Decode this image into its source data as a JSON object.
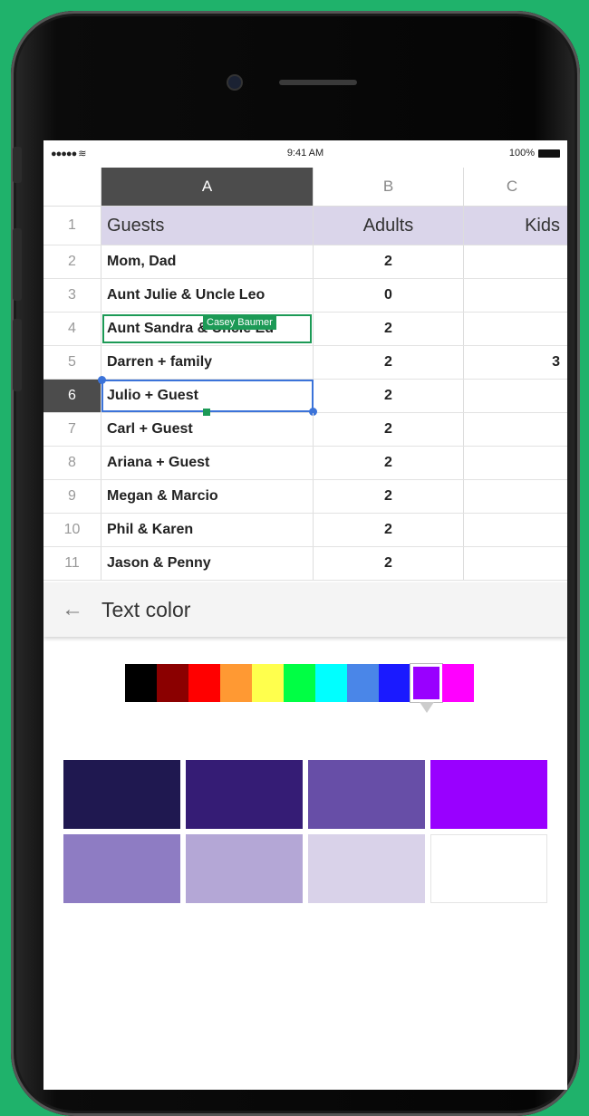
{
  "status": {
    "signal": "●●●●● ",
    "wifi": "≋",
    "time": "9:41 AM",
    "battery": "100%"
  },
  "columns": [
    "A",
    "B",
    "C"
  ],
  "rows": [
    {
      "num": "1",
      "a": "Guests",
      "b": "Adults",
      "c": "Kids"
    },
    {
      "num": "2",
      "a": "Mom, Dad",
      "b": "2",
      "c": ""
    },
    {
      "num": "3",
      "a": "Aunt Julie & Uncle Leo",
      "b": "0",
      "c": ""
    },
    {
      "num": "4",
      "a": "Aunt Sandra & Uncle Ed",
      "b": "2",
      "c": ""
    },
    {
      "num": "5",
      "a": "Darren + family",
      "b": "2",
      "c": "3"
    },
    {
      "num": "6",
      "a": "Julio + Guest",
      "b": "2",
      "c": ""
    },
    {
      "num": "7",
      "a": "Carl + Guest",
      "b": "2",
      "c": ""
    },
    {
      "num": "8",
      "a": "Ariana + Guest",
      "b": "2",
      "c": ""
    },
    {
      "num": "9",
      "a": "Megan & Marcio",
      "b": "2",
      "c": ""
    },
    {
      "num": "10",
      "a": "Phil & Karen",
      "b": "2",
      "c": ""
    },
    {
      "num": "11",
      "a": "Jason & Penny",
      "b": "2",
      "c": ""
    }
  ],
  "collaborator": "Casey Baumer",
  "panel": {
    "back_icon": "←",
    "title": "Text color"
  },
  "palette": [
    "#000000",
    "#8b0000",
    "#ff0000",
    "#ff9933",
    "#ffff4d",
    "#00ff44",
    "#00ffff",
    "#4a86e8",
    "#1a1aff",
    "#9900ff",
    "#ff00ff"
  ],
  "palette_selected": 9,
  "shades": [
    "#1f1850",
    "#351c75",
    "#674ea7",
    "#9900ff",
    "#8e7cc3",
    "#b4a7d6",
    "#d9d2e9",
    "#ffffff"
  ]
}
